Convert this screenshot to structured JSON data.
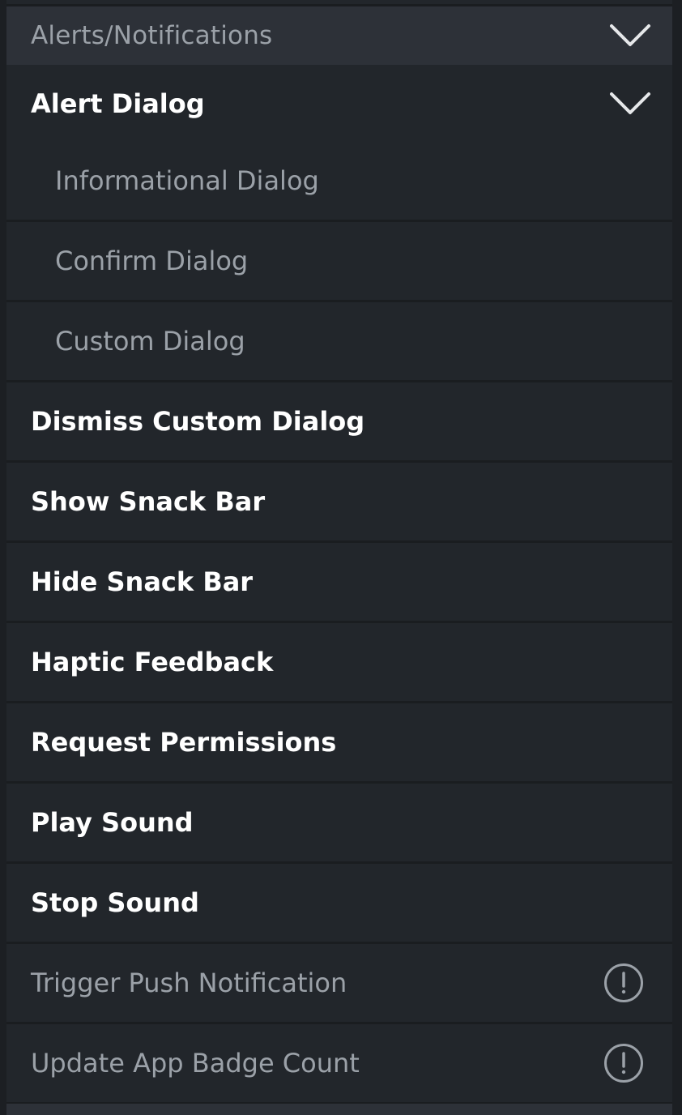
{
  "section": {
    "title": "Alerts/Notifications",
    "expand_icon": "chevron-down-icon"
  },
  "group": {
    "title": "Alert Dialog",
    "expand_icon": "chevron-down-icon"
  },
  "sub_items": [
    {
      "label": "Informational Dialog"
    },
    {
      "label": "Confirm Dialog"
    },
    {
      "label": "Custom Dialog"
    }
  ],
  "items": [
    {
      "label": "Dismiss Custom Dialog"
    },
    {
      "label": "Show Snack Bar"
    },
    {
      "label": "Hide Snack Bar"
    },
    {
      "label": "Haptic Feedback"
    },
    {
      "label": "Request Permissions"
    },
    {
      "label": "Play Sound"
    },
    {
      "label": "Stop Sound"
    }
  ],
  "disabled_items": [
    {
      "label": "Trigger Push Notification",
      "icon": "warning-circle-icon"
    },
    {
      "label": "Update App Badge Count",
      "icon": "warning-circle-icon"
    }
  ],
  "colors": {
    "background": "#22262b",
    "header_background": "#2d3138",
    "text_primary": "#ffffff",
    "text_secondary": "#9ba1a8",
    "divider": "#1a1d20"
  }
}
